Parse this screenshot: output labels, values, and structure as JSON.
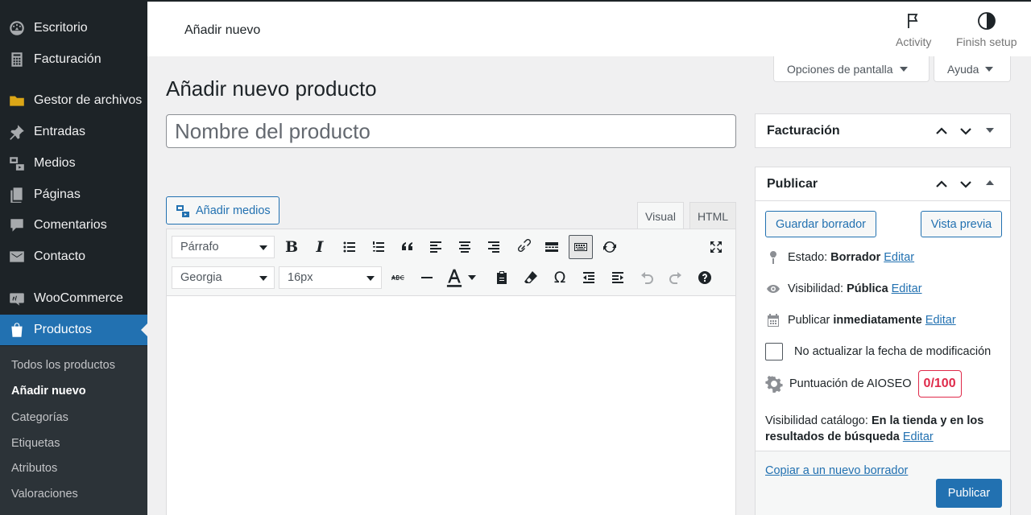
{
  "sidebar": {
    "items": [
      {
        "label": "Escritorio",
        "icon": "dashboard-icon"
      },
      {
        "label": "Facturación",
        "icon": "invoice-icon"
      },
      {
        "label": "Gestor de archivos",
        "icon": "folder-icon"
      },
      {
        "label": "Entradas",
        "icon": "pin-icon"
      },
      {
        "label": "Medios",
        "icon": "media-icon"
      },
      {
        "label": "Páginas",
        "icon": "pages-icon"
      },
      {
        "label": "Comentarios",
        "icon": "comments-icon"
      },
      {
        "label": "Contacto",
        "icon": "mail-icon"
      },
      {
        "label": "WooCommerce",
        "icon": "woocommerce-icon"
      },
      {
        "label": "Productos",
        "icon": "products-icon"
      }
    ],
    "submenu": [
      "Todos los productos",
      "Añadir nuevo",
      "Categorías",
      "Etiquetas",
      "Atributos",
      "Valoraciones"
    ]
  },
  "topbar": {
    "title": "Añadir nuevo",
    "activity_label": "Activity",
    "finish_setup_label": "Finish setup"
  },
  "screen_options": {
    "options_label": "Opciones de pantalla",
    "help_label": "Ayuda"
  },
  "page": {
    "title": "Añadir nuevo producto",
    "title_placeholder": "Nombre del producto"
  },
  "editor": {
    "add_media_label": "Añadir medios",
    "tab_visual": "Visual",
    "tab_html": "HTML",
    "format_select": "Párrafo",
    "font_select": "Georgia",
    "size_select": "16px"
  },
  "facturacion_box": {
    "title": "Facturación"
  },
  "publish_box": {
    "title": "Publicar",
    "save_draft": "Guardar borrador",
    "preview": "Vista previa",
    "status_label": "Estado:",
    "status_value": "Borrador",
    "visibility_label": "Visibilidad:",
    "visibility_value": "Pública",
    "publish_label": "Publicar",
    "publish_value": "inmediatamente",
    "edit_link": "Editar",
    "no_update_label": "No actualizar la fecha de modificación",
    "aioseo_label": "Puntuación de AIOSEO",
    "aioseo_score": "0/100",
    "catalog_label": "Visibilidad catálogo:",
    "catalog_value_1": "En la tienda y en los",
    "catalog_value_2": "resultados de búsqueda",
    "copy_draft_link": "Copiar a un nuevo borrador",
    "publish_button": "Publicar"
  },
  "colors": {
    "sidebar_bg": "#1d2327",
    "accent": "#2271b1",
    "aioseo_red": "#df2a4a"
  }
}
